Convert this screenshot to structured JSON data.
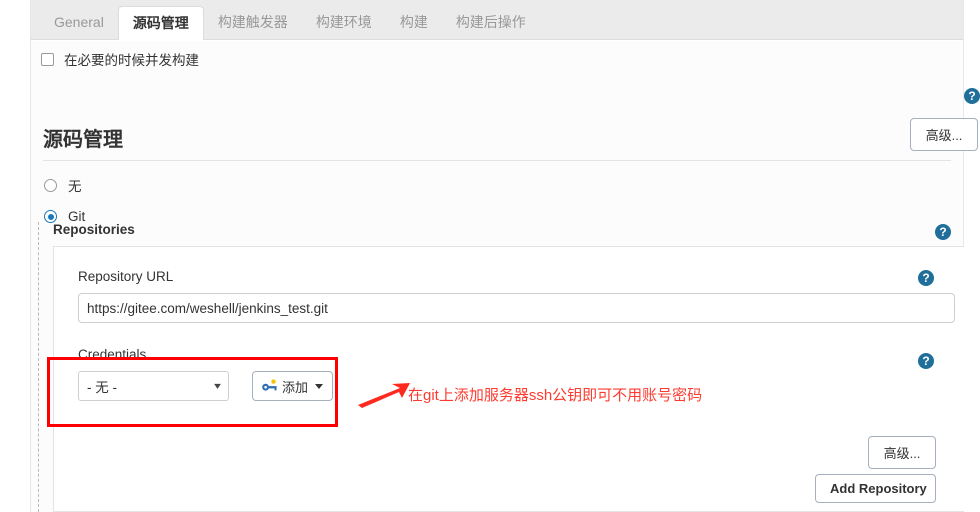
{
  "tabs": [
    {
      "label": "General",
      "active": false
    },
    {
      "label": "源码管理",
      "active": true
    },
    {
      "label": "构建触发器",
      "active": false
    },
    {
      "label": "构建环境",
      "active": false
    },
    {
      "label": "构建",
      "active": false
    },
    {
      "label": "构建后操作",
      "active": false
    }
  ],
  "concurrent": {
    "label": "在必要的时候并发构建",
    "checked": false,
    "help_glyph": "?"
  },
  "advanced_top": {
    "label": "高级..."
  },
  "section": {
    "title": "源码管理",
    "scm_options": [
      {
        "label": "无",
        "selected": false
      },
      {
        "label": "Git",
        "selected": true
      }
    ]
  },
  "repositories": {
    "label": "Repositories",
    "help_glyph": "?",
    "url_field": {
      "label": "Repository URL",
      "value": "https://gitee.com/weshell/jenkins_test.git",
      "placeholder": "",
      "help_glyph": "?"
    },
    "credentials": {
      "label": "Credentials",
      "selected": "- 无 -",
      "options": [
        "- 无 -"
      ],
      "add_button": "添加",
      "add_icon": "key-icon",
      "help_glyph": "?"
    },
    "advanced_button": "高级...",
    "add_repository_button": "Add Repository"
  },
  "annotation": {
    "text": "在git上添加服务器ssh公钥即可不用账号密码",
    "color": "#fe3b30",
    "box_color": "#fe0000",
    "arrow": "red-arrow-right"
  },
  "colors": {
    "accent": "#1b75bb",
    "help_bg": "#1f6f9a",
    "tab_bar_bg": "#ebebeb",
    "content_bg": "#fcfcfc",
    "key_icon_body": "#2e6fb5",
    "key_icon_tip": "#f3c200"
  }
}
